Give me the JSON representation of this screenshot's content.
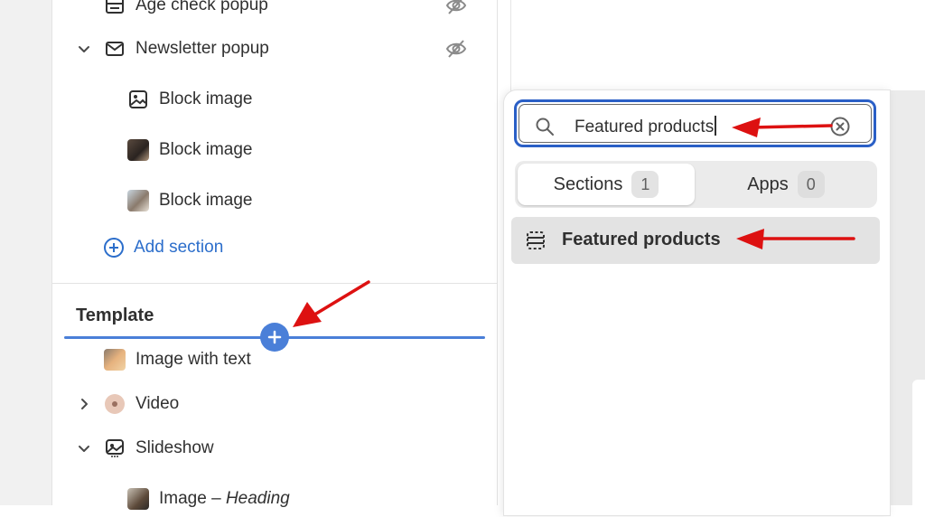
{
  "sidebar": {
    "items": [
      {
        "label": "Age check popup",
        "icon": "popup-icon"
      },
      {
        "label": "Newsletter popup",
        "icon": "mail-icon"
      },
      {
        "label": "Block image",
        "icon": "image-icon"
      },
      {
        "label": "Block image",
        "icon": "image-thumbnail"
      },
      {
        "label": "Block image",
        "icon": "image-thumbnail"
      }
    ],
    "add_section_label": "Add section",
    "template_title": "Template",
    "template_items": [
      {
        "label": "Image with text",
        "icon": "image-thumbnail"
      },
      {
        "label": "Video",
        "icon": "video-thumbnail"
      },
      {
        "label": "Slideshow",
        "icon": "slideshow-icon"
      }
    ],
    "partial_item": {
      "label_main": "Image",
      "label_sep": " – ",
      "label_sub": "Heading"
    }
  },
  "picker": {
    "search_value": "Featured products",
    "tabs": [
      {
        "label": "Sections",
        "count": "1",
        "active": true
      },
      {
        "label": "Apps",
        "count": "0",
        "active": false
      }
    ],
    "results": [
      {
        "label": "Featured products",
        "icon": "section-layout-icon"
      }
    ]
  },
  "colors": {
    "accent": "#2c6ecb",
    "insert_line": "#4a7fd8",
    "annotation_arrow": "#dd1111",
    "search_focus": "#2a5fc6"
  }
}
